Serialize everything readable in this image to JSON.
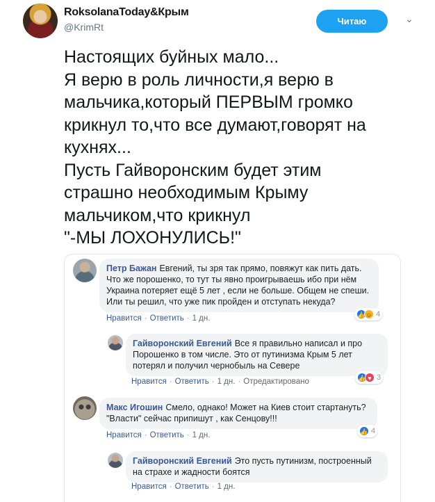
{
  "tweet": {
    "author_name": "RoksolanaToday&Крым",
    "author_handle": "@KrimRt",
    "follow_label": "Читаю",
    "menu_icon": "chevron-down-icon",
    "text_lines": [
      "Настоящих буйных мало...",
      "Я верю в роль личности,я верю в",
      "мальчика,который ПЕРВЫМ громко",
      "крикнул то,что все думают,говорят на",
      "кухнях...",
      "Пусть Гайворонским будет этим",
      "страшно необходимым Крыму",
      "мальчиком,что крикнул",
      "\"-МЫ ЛОХОНУЛИСЬ!\""
    ],
    "accent_color": "#1da1f2"
  },
  "fb": {
    "comments": [
      {
        "author": "Петр Бажан",
        "text": "Евгений, ты зря так прямо, повяжут как пить дать. Что же порошенко, то тут ты явно проигрываешь ибо при нём Украина потеряет ещё 5 лет , если не больше. Общем не спеши. Или ты решил, что уже пик пройден и отступать некуда?",
        "like": "Нравится",
        "reply": "Ответить",
        "time": "1 дн.",
        "reaction_count": "4"
      },
      {
        "author": "Гайворонский Евгений",
        "text": "Все я правильно написал и про Порошенко в том числе. Это от путинизма Крым 5 лет потерял и получил чернобыль на Севере",
        "like": "Нравится",
        "reply": "Ответить",
        "time": "1 дн.",
        "edited": "Отредактировано",
        "reaction_count": "3"
      },
      {
        "author": "Макс Игошин",
        "text": "Смело, однако! Может на Киев стоит стартануть? \"Власти\" сейчас припишут , как Сенцову!!!",
        "like": "Нравится",
        "reply": "Ответить",
        "time": "1 дн.",
        "reaction_count": "4"
      },
      {
        "author": "Гайворонский Евгений",
        "text": "Это пусть путинизм, построенный на страхе и жадности боятся",
        "like": "Нравится",
        "reply": "Ответить",
        "time": "1 дн."
      }
    ],
    "link_color": "#385898"
  }
}
